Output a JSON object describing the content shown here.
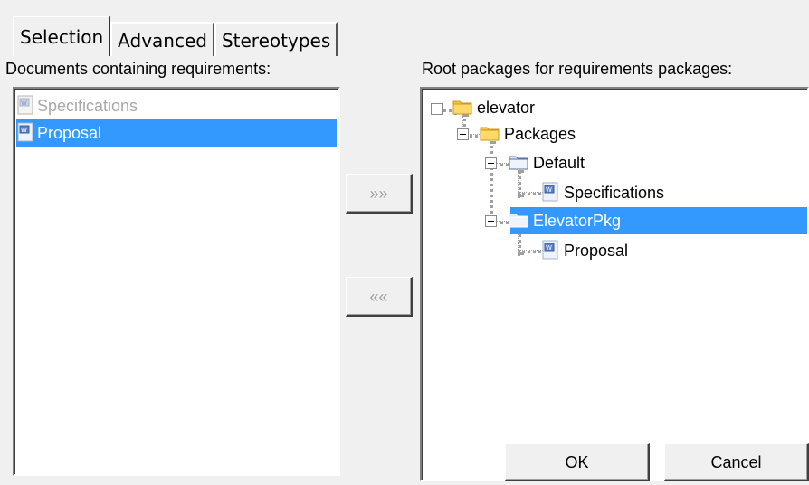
{
  "tabs": [
    {
      "label": "Selection",
      "active": true
    },
    {
      "label": "Advanced",
      "active": false
    },
    {
      "label": "Stereotypes",
      "active": false
    }
  ],
  "left": {
    "label": "Documents containing requirements:",
    "items": [
      {
        "label": "Specifications",
        "state": "disabled"
      },
      {
        "label": "Proposal",
        "state": "selected"
      }
    ]
  },
  "right": {
    "label": "Root packages for requirements packages:",
    "tree": [
      {
        "label": "elevator",
        "icon": "folder-icon",
        "level": 0,
        "expanded": true
      },
      {
        "label": "Packages",
        "icon": "folder-icon",
        "level": 1,
        "expanded": true
      },
      {
        "label": "Default",
        "icon": "package-folder-icon",
        "level": 2,
        "expanded": true
      },
      {
        "label": "Specifications",
        "icon": "document-icon",
        "level": 3
      },
      {
        "label": "ElevatorPkg",
        "icon": "package-folder-icon",
        "level": 2,
        "expanded": true,
        "selected": true
      },
      {
        "label": "Proposal",
        "icon": "document-icon",
        "level": 3
      }
    ]
  },
  "buttons": {
    "add_glyph": "»»",
    "remove_glyph": "««",
    "ok": "OK",
    "cancel": "Cancel"
  },
  "colors": {
    "selection": "#3399ff",
    "background": "#f0f0f0",
    "folder": "#f5c542"
  }
}
